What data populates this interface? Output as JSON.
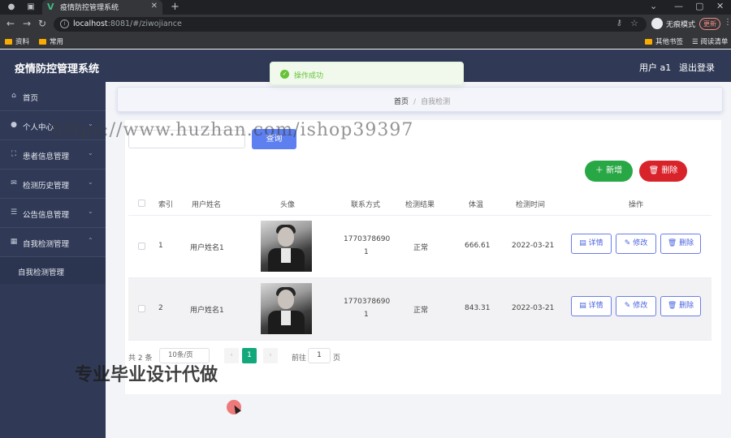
{
  "browser": {
    "tab_title": "疫情防控管理系统",
    "url_host": "localhost",
    "url_rest": ":8081/#/ziwojiance",
    "incognito_label": "无痕模式",
    "update_label": "更新",
    "bookmarks": [
      "资料",
      "常用"
    ],
    "other_bookmarks": "其他书签",
    "reading_list": "阅读清单"
  },
  "header": {
    "app_title": "疫情防控管理系统",
    "user": "用户 a1",
    "logout": "退出登录"
  },
  "sidebar": {
    "items": [
      {
        "label": "首页",
        "icon": "home-icon",
        "has_arrow": false
      },
      {
        "label": "个人中心",
        "icon": "user-icon",
        "has_arrow": true
      },
      {
        "label": "患者信息管理",
        "icon": "clipboard-icon",
        "has_arrow": true
      },
      {
        "label": "检测历史管理",
        "icon": "mail-icon",
        "has_arrow": true
      },
      {
        "label": "公告信息管理",
        "icon": "list-icon",
        "has_arrow": true
      },
      {
        "label": "自我检测管理",
        "icon": "grid-icon",
        "has_arrow": true,
        "expanded": true
      }
    ],
    "subitem": "自我检测管理"
  },
  "breadcrumb": {
    "home": "首页",
    "separator": "/",
    "current": "自我检测"
  },
  "toolbar": {
    "search_button": "查询",
    "add_button": "新增",
    "delete_button": "删除"
  },
  "table": {
    "columns": [
      "索引",
      "用户姓名",
      "头像",
      "联系方式",
      "检测结果",
      "体温",
      "检测时间",
      "操作"
    ],
    "rows": [
      {
        "index": "1",
        "name": "用户姓名1",
        "phone_1": "1770378690",
        "phone_2": "1",
        "result": "正常",
        "temp": "666.61",
        "time": "2022-03-21"
      },
      {
        "index": "2",
        "name": "用户姓名1",
        "phone_1": "1770378690",
        "phone_2": "1",
        "result": "正常",
        "temp": "843.31",
        "time": "2022-03-21"
      }
    ],
    "actions": {
      "detail": "详情",
      "edit": "修改",
      "delete": "删除"
    }
  },
  "pagination": {
    "total": "共 2 条",
    "page_size": "10条/页",
    "current_page": "1",
    "goto_label": "前往",
    "goto_value": "1",
    "page_suffix": "页"
  },
  "toast": {
    "message": "操作成功"
  },
  "overlay": {
    "watermark_url": "https://www.huzhan.com/ishop39397",
    "watermark_cn": "专业毕业设计代做"
  },
  "colors": {
    "sidebar_bg": "#303a56",
    "primary": "#5d7ff0",
    "success": "#28a745",
    "danger": "#d9232b",
    "page_active": "#13a87b"
  }
}
